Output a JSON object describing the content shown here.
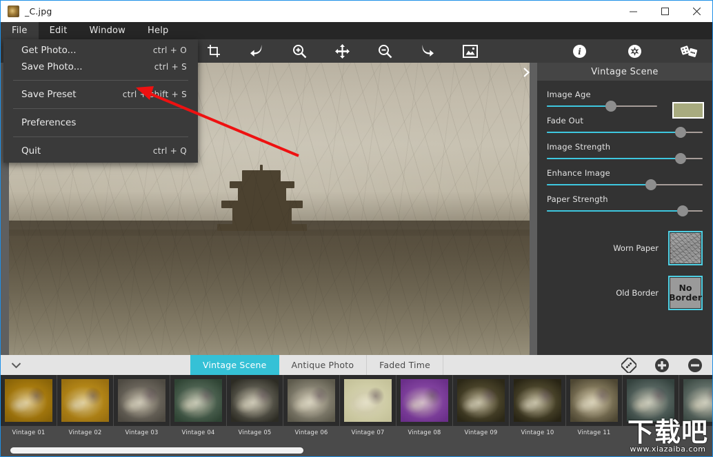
{
  "window": {
    "title": "_C.jpg",
    "icon": "photo-thumbnail-icon",
    "minimize": "minimize",
    "maximize": "maximize",
    "close": "close"
  },
  "menubar": {
    "items": [
      {
        "label": "File",
        "active": true
      },
      {
        "label": "Edit",
        "active": false
      },
      {
        "label": "Window",
        "active": false
      },
      {
        "label": "Help",
        "active": false
      }
    ]
  },
  "file_menu": {
    "items": [
      {
        "label": "Get Photo...",
        "shortcut": "ctrl + O"
      },
      {
        "label": "Save Photo...",
        "shortcut": "ctrl + S"
      },
      {
        "label": "Save Preset",
        "shortcut": "ctrl + shift + S"
      },
      {
        "label": "Preferences",
        "shortcut": ""
      },
      {
        "label": "Quit",
        "shortcut": "ctrl + Q"
      }
    ]
  },
  "toolbar": {
    "left_icons": [
      "crop-icon",
      "undo-arrow-icon",
      "zoom-in-icon",
      "move-icon",
      "zoom-out-icon",
      "redo-arrow-icon",
      "fit-image-icon"
    ],
    "right_icons": [
      "info-icon",
      "settings-circle-icon",
      "dice-random-icon"
    ]
  },
  "canvas": {
    "expand_chevron": "chevron-right-icon",
    "annotation": "red-arrow-annotation"
  },
  "right_panel": {
    "title": "Vintage Scene",
    "sliders": [
      {
        "label": "Image Age",
        "value": 58,
        "track_short": true
      },
      {
        "label": "Fade Out",
        "value": 86,
        "track_short": false
      },
      {
        "label": "Image Strength",
        "value": 86,
        "track_short": false
      },
      {
        "label": "Enhance Image",
        "value": 67,
        "track_short": false
      },
      {
        "label": "Paper Strength",
        "value": 87,
        "track_short": false
      }
    ],
    "swatch_color": "#a8ab7f",
    "pickers": [
      {
        "label": "Worn Paper",
        "type": "texture",
        "text": ""
      },
      {
        "label": "Old Border",
        "type": "text",
        "text": "No Border"
      }
    ],
    "accent_color": "#3ec8e0",
    "selection_color": "#4fd0e4"
  },
  "tabbar": {
    "collapse_icon": "chevron-down-icon",
    "tabs": [
      {
        "label": "Vintage Scene",
        "active": true
      },
      {
        "label": "Antique Photo",
        "active": false
      },
      {
        "label": "Faded Time",
        "active": false
      }
    ],
    "right_icons": [
      "preset-options-icon",
      "add-preset-icon",
      "remove-preset-icon"
    ],
    "active_color": "#35c1d6"
  },
  "filmstrip": {
    "thumbnails": [
      {
        "label": "Vintage 01",
        "color1": "#c99516",
        "color2": "#8a6408"
      },
      {
        "label": "Vintage 02",
        "color1": "#d0a021",
        "color2": "#9a7010"
      },
      {
        "label": "Vintage 03",
        "color1": "#8b8478",
        "color2": "#4e4a42"
      },
      {
        "label": "Vintage 04",
        "color1": "#6f8472",
        "color2": "#2f4434"
      },
      {
        "label": "Vintage 05",
        "color1": "#8d8a7c",
        "color2": "#2d2c24"
      },
      {
        "label": "Vintage 06",
        "color1": "#b3ad9b",
        "color2": "#5d5a4c"
      },
      {
        "label": "Vintage 07",
        "color1": "#dedcb7",
        "color2": "#c5c29a"
      },
      {
        "label": "Vintage 08",
        "color1": "#9b59b6",
        "color2": "#6b2f8a"
      },
      {
        "label": "Vintage 09",
        "color1": "#6d6440",
        "color2": "#2c2817"
      },
      {
        "label": "Vintage 10",
        "color1": "#726a45",
        "color2": "#282414"
      },
      {
        "label": "Vintage 11",
        "color1": "#b8ab85",
        "color2": "#4e4733"
      },
      {
        "label": "",
        "color1": "#7d8c86",
        "color2": "#34423e"
      },
      {
        "label": "",
        "color1": "#8e9a92",
        "color2": "#3c4a44"
      }
    ]
  },
  "scrollbar": {
    "thumb_percent": 42
  },
  "watermark": {
    "main": "下载吧",
    "sub": "www.xiazaiba.com"
  }
}
